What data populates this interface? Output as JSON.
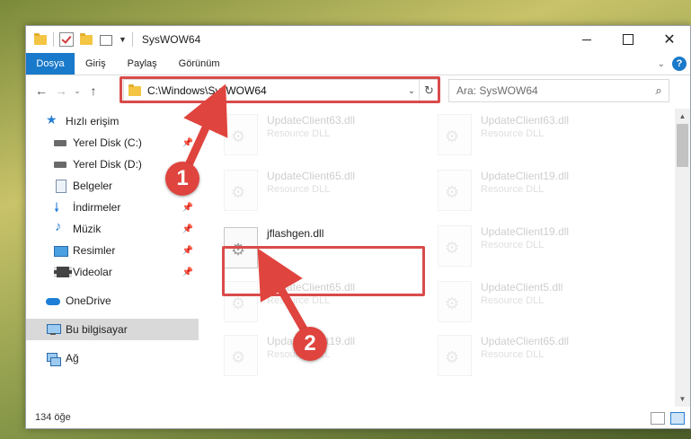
{
  "window": {
    "title": "SysWOW64",
    "controls": {
      "minimize": "",
      "maximize": "",
      "close": "✕"
    }
  },
  "ribbon": {
    "tabs": [
      "Dosya",
      "Giriş",
      "Paylaş",
      "Görünüm"
    ],
    "help": "?"
  },
  "nav": {
    "back": "←",
    "forward": "→",
    "recent": "⌄",
    "up": "↑",
    "address": "C:\\Windows\\SysWOW64",
    "refresh": "↻",
    "search_placeholder": "Ara: SysWOW64",
    "search_icon": "⌕"
  },
  "sidebar": {
    "items": [
      {
        "label": "Hızlı erişim",
        "icon": "star-icon",
        "pinned": false
      },
      {
        "label": "Yerel Disk (C:)",
        "icon": "drive-icon",
        "pinned": true
      },
      {
        "label": "Yerel Disk (D:)",
        "icon": "drive-icon",
        "pinned": true
      },
      {
        "label": "Belgeler",
        "icon": "document-icon",
        "pinned": true
      },
      {
        "label": "İndirmeler",
        "icon": "download-icon",
        "pinned": true
      },
      {
        "label": "Müzik",
        "icon": "music-icon",
        "pinned": true
      },
      {
        "label": "Resimler",
        "icon": "pictures-icon",
        "pinned": true
      },
      {
        "label": "Videolar",
        "icon": "video-icon",
        "pinned": true
      },
      {
        "label": "OneDrive",
        "icon": "onedrive-icon",
        "pinned": false
      },
      {
        "label": "Bu bilgisayar",
        "icon": "this-pc-icon",
        "pinned": false,
        "selected": true
      },
      {
        "label": "Ağ",
        "icon": "network-icon",
        "pinned": false
      }
    ]
  },
  "files": {
    "left_column": [
      {
        "name": "UpdateClient63.dll",
        "type": "Resource DLL",
        "faded": true
      },
      {
        "name": "UpdateClient65.dll",
        "type": "Resource DLL",
        "faded": true
      },
      {
        "name": "jflashgen.dll",
        "type": "",
        "faded": false,
        "highlighted": true
      },
      {
        "name": "UpdateClient65.dll",
        "type": "Resource DLL",
        "faded": true
      },
      {
        "name": "UpdateClient19.dll",
        "type": "Resource DLL",
        "faded": true
      }
    ],
    "right_column": [
      {
        "name": "UpdateClient63.dll",
        "type": "Resource DLL",
        "faded": true
      },
      {
        "name": "UpdateClient19.dll",
        "type": "Resource DLL",
        "faded": true
      },
      {
        "name": "UpdateClient19.dll",
        "type": "Resource DLL",
        "faded": true
      },
      {
        "name": "UpdateClient5.dll",
        "type": "Resource DLL",
        "faded": true
      },
      {
        "name": "UpdateClient65.dll",
        "type": "Resource DLL",
        "faded": true
      }
    ]
  },
  "status": {
    "count": "134 öğe"
  },
  "annotations": {
    "step1": "1",
    "step2": "2"
  },
  "colors": {
    "accent": "#1979ca",
    "highlight_red": "#d94b4b"
  }
}
